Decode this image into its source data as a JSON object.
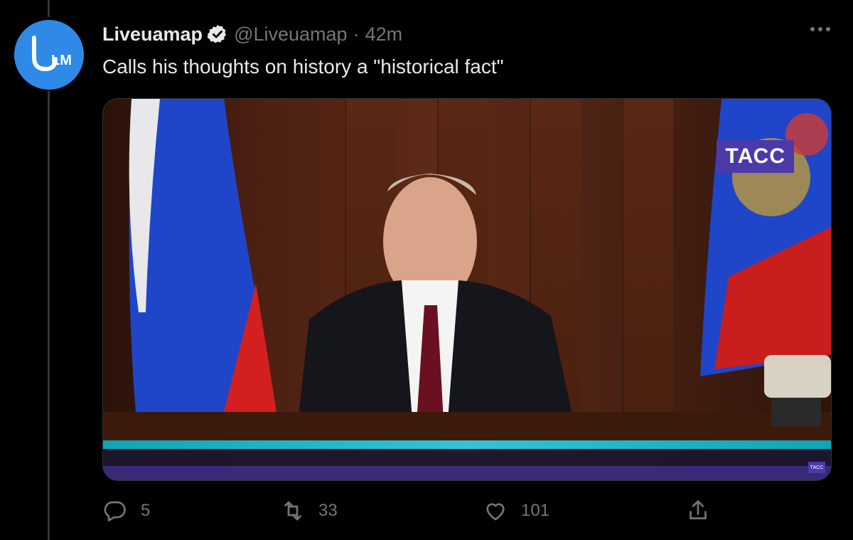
{
  "tweet": {
    "author_name": "Liveuamap",
    "handle": "@Liveuamap",
    "separator": "·",
    "time": "42m",
    "text": "Calls his thoughts on history a \"historical fact\"",
    "avatar_text": "LM"
  },
  "media": {
    "watermark": "ТАСС",
    "watermark_small": "ТАСС"
  },
  "actions": {
    "replies": "5",
    "retweets": "33",
    "likes": "101"
  },
  "icons": [
    "more-icon",
    "verified-icon",
    "reply-icon",
    "retweet-icon",
    "like-icon",
    "share-icon"
  ],
  "colors": {
    "accent": "#1d9bf0",
    "avatar": "#2e8ae6",
    "muted": "#71767b"
  }
}
